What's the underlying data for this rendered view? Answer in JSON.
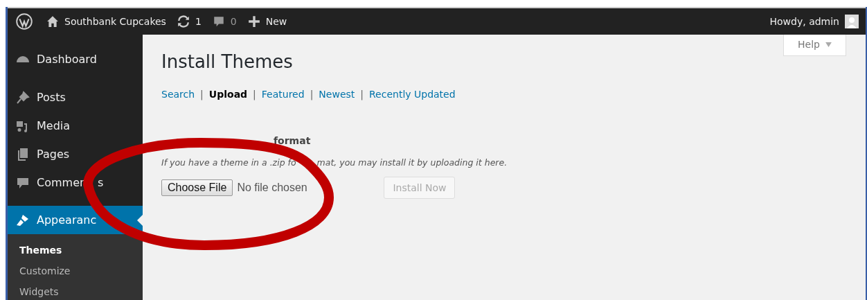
{
  "admin_bar": {
    "site_name": "Southbank Cupcakes",
    "updates_count": "1",
    "comments_count": "0",
    "new_label": "New",
    "greeting": "Howdy, admin"
  },
  "sidebar": {
    "items": [
      {
        "label": "Dashboard",
        "kind": "dashboard",
        "selected": false
      },
      {
        "label": "Posts",
        "kind": "posts",
        "selected": false
      },
      {
        "label": "Media",
        "kind": "media",
        "selected": false
      },
      {
        "label": "Pages",
        "kind": "pages",
        "selected": false
      },
      {
        "label": "Commen",
        "label_after_cover": "s",
        "kind": "comments",
        "selected": false
      },
      {
        "label": "Appearanc",
        "kind": "appearance",
        "selected": true
      }
    ],
    "submenu": [
      {
        "label": "Themes",
        "selected": true
      },
      {
        "label": "Customize",
        "selected": false
      },
      {
        "label": "Widgets",
        "selected": false
      }
    ]
  },
  "help_button": "Help",
  "page_title": "Install Themes",
  "tab_separator": "|",
  "tabs": [
    {
      "label": "Search",
      "selected": false
    },
    {
      "label": "Upload",
      "selected": true
    },
    {
      "label": "Featured",
      "selected": false
    },
    {
      "label": "Newest",
      "selected": false
    },
    {
      "label": "Recently Updated",
      "selected": false
    }
  ],
  "upload": {
    "heading_visible": "format",
    "hint_before_cover": "If you have a theme in a .zip fo",
    "hint_after_cover": "mat, you may install it by uploading it here.",
    "choose_button": "Choose File",
    "file_status": "No file chosen",
    "install_button": "Install Now",
    "install_disabled": true
  }
}
